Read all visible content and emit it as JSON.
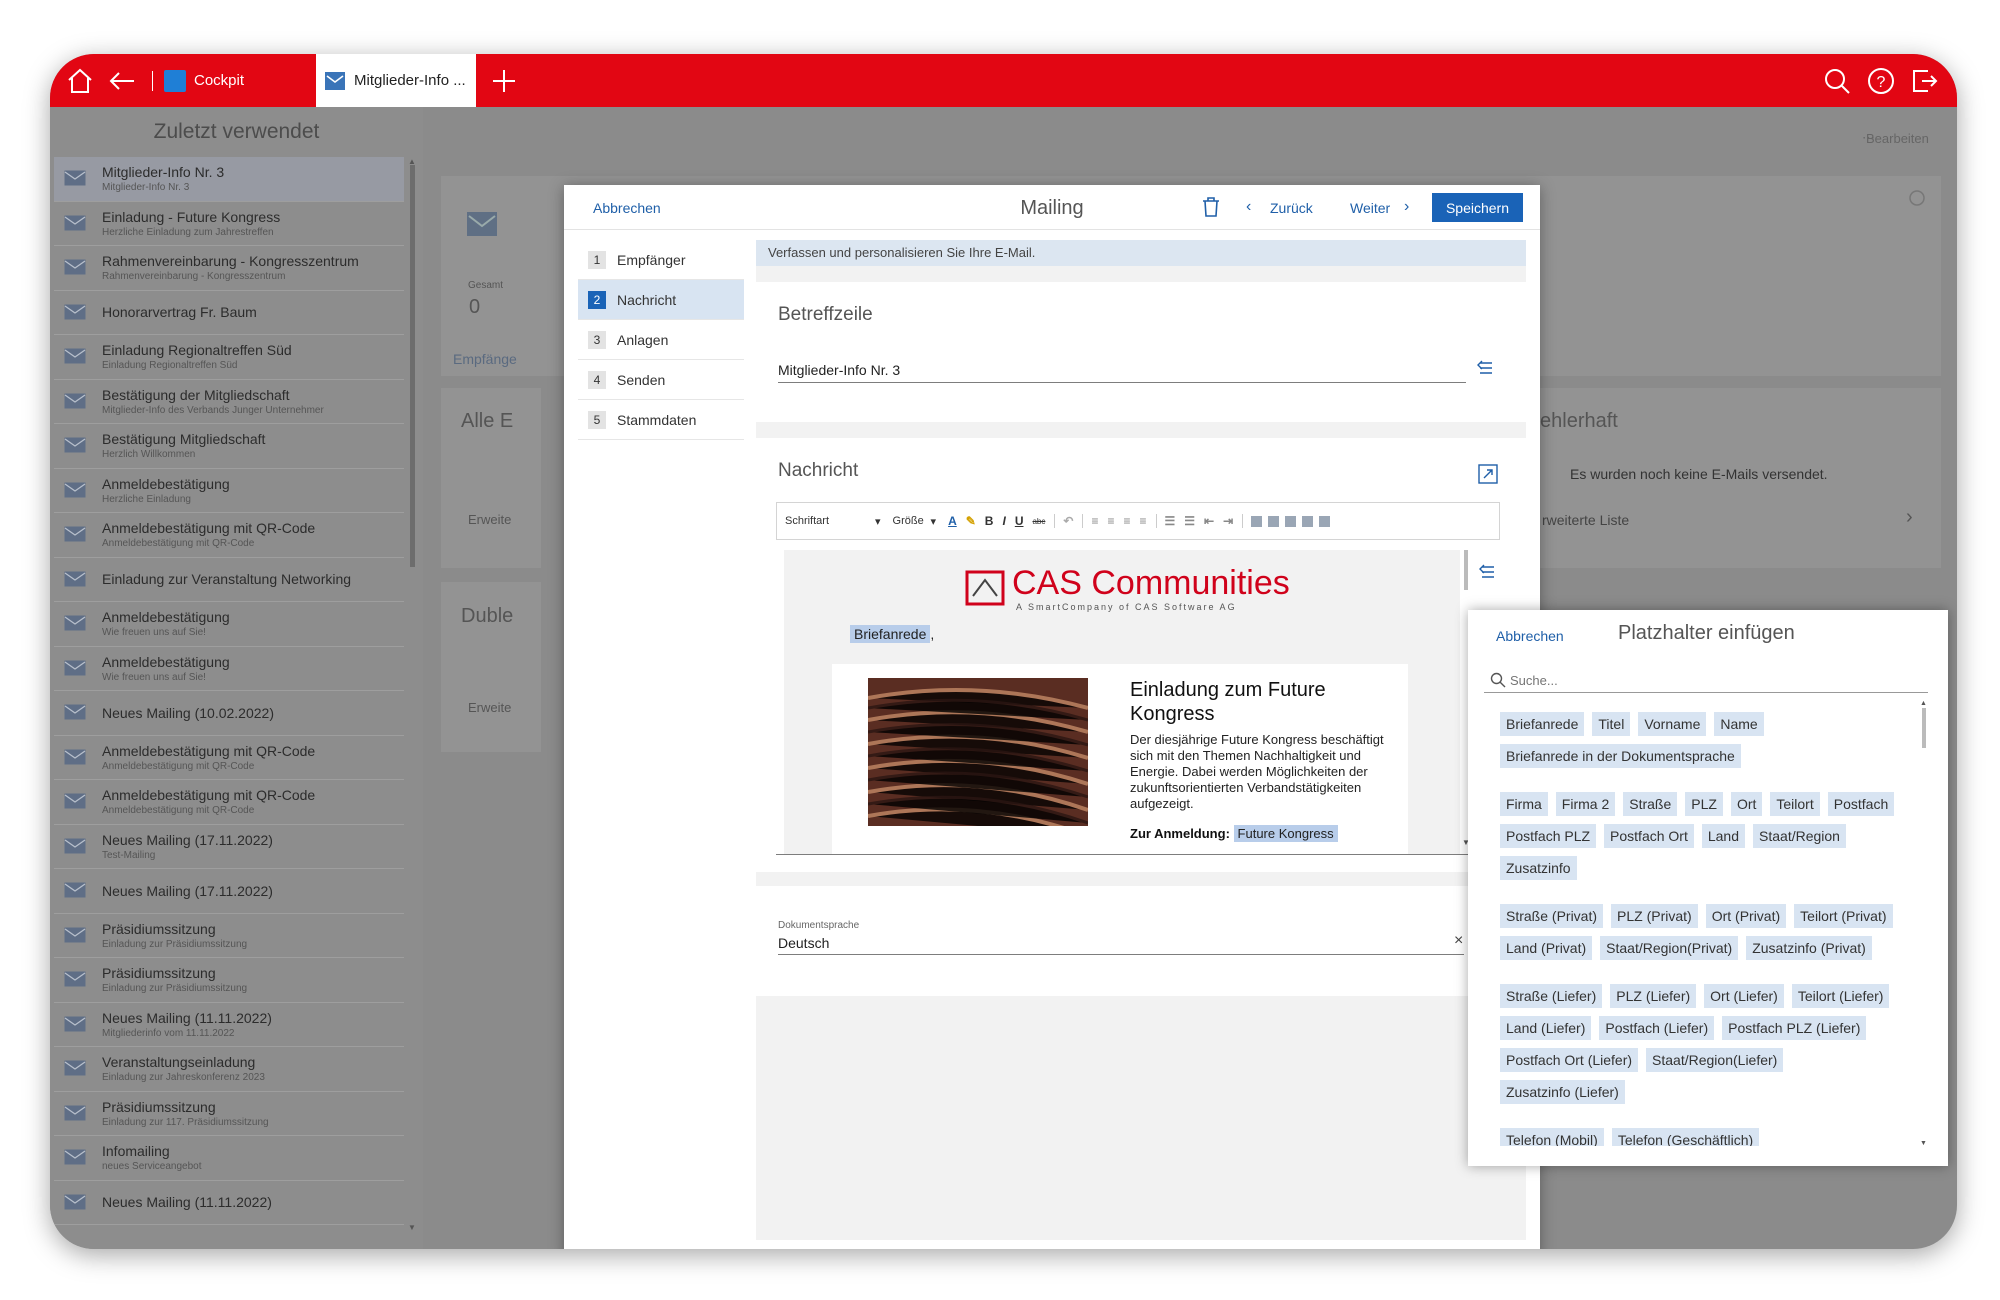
{
  "topbar": {
    "tabs": [
      {
        "label": "Cockpit"
      },
      {
        "label": "Mitglieder-Info ..."
      }
    ]
  },
  "left_panel": {
    "title": "Zuletzt verwendet",
    "items": [
      {
        "title": "Mitglieder-Info Nr. 3",
        "subtitle": "Mitglieder-Info Nr. 3"
      },
      {
        "title": "Einladung - Future Kongress",
        "subtitle": "Herzliche Einladung zum Jahrestreffen"
      },
      {
        "title": "Rahmenvereinbarung - Kongresszentrum",
        "subtitle": "Rahmenvereinbarung - Kongresszentrum"
      },
      {
        "title": "Honorarvertrag Fr. Baum",
        "subtitle": ""
      },
      {
        "title": "Einladung Regionaltreffen Süd",
        "subtitle": "Einladung Regionaltreffen Süd"
      },
      {
        "title": "Bestätigung der Mitgliedschaft",
        "subtitle": "Mitglieder-Info des Verbands Junger Unternehmer"
      },
      {
        "title": "Bestätigung Mitgliedschaft",
        "subtitle": "Herzlich Willkommen"
      },
      {
        "title": "Anmeldebestätigung",
        "subtitle": "Herzliche Einladung"
      },
      {
        "title": "Anmeldebestätigung mit QR-Code",
        "subtitle": "Anmeldebestätigung mit QR-Code"
      },
      {
        "title": "Einladung zur Veranstaltung Networking",
        "subtitle": ""
      },
      {
        "title": "Anmeldebestätigung",
        "subtitle": "Wie freuen uns auf Sie!"
      },
      {
        "title": "Anmeldebestätigung",
        "subtitle": "Wie freuen uns auf Sie!"
      },
      {
        "title": "Neues Mailing (10.02.2022)",
        "subtitle": ""
      },
      {
        "title": "Anmeldebestätigung mit QR-Code",
        "subtitle": "Anmeldebestätigung mit QR-Code"
      },
      {
        "title": "Anmeldebestätigung mit QR-Code",
        "subtitle": "Anmeldebestätigung mit QR-Code"
      },
      {
        "title": "Neues Mailing (17.11.2022)",
        "subtitle": "Test-Mailing"
      },
      {
        "title": "Neues Mailing (17.11.2022)",
        "subtitle": ""
      },
      {
        "title": "Präsidiumssitzung",
        "subtitle": "Einladung zur Präsidiumssitzung"
      },
      {
        "title": "Präsidiumssitzung",
        "subtitle": "Einladung zur Präsidiumssitzung"
      },
      {
        "title": "Neues Mailing (11.11.2022)",
        "subtitle": "Mitgliederinfo vom 11.11.2022"
      },
      {
        "title": "Veranstaltungseinladung",
        "subtitle": "Einladung zur Jahreskonferenz 2023"
      },
      {
        "title": "Präsidiumssitzung",
        "subtitle": "Einladung zur 117. Präsidiumssitzung"
      },
      {
        "title": "Infomailing",
        "subtitle": "neues Serviceangebot"
      },
      {
        "title": "Neues Mailing (11.11.2022)",
        "subtitle": ""
      }
    ]
  },
  "background": {
    "edit_label": "Bearbeiten",
    "gesamt_label": "Gesamt",
    "gesamt_value": "0",
    "tab_label": "Empfänge",
    "card1_title": "Alle E",
    "card1_link": "Erweite",
    "card2_title": "Duble",
    "card2_link": "Erweite",
    "right_title": "ehlerhaft",
    "right_empty": "Es wurden noch keine E-Mails versendet.",
    "right_link": "rweiterte Liste"
  },
  "dialog": {
    "cancel": "Abbrechen",
    "title": "Mailing",
    "back": "Zurück",
    "next": "Weiter",
    "save": "Speichern",
    "steps": [
      {
        "n": "1",
        "label": "Empfänger"
      },
      {
        "n": "2",
        "label": "Nachricht"
      },
      {
        "n": "3",
        "label": "Anlagen"
      },
      {
        "n": "4",
        "label": "Senden"
      },
      {
        "n": "5",
        "label": "Stammdaten"
      }
    ],
    "info": "Verfassen und personalisieren Sie Ihre E-Mail.",
    "subject_title": "Betreffzeile",
    "subject_value": "Mitglieder-Info Nr. 3",
    "message_title": "Nachricht",
    "toolbar": {
      "font": "Schriftart",
      "size": "Größe"
    },
    "editor": {
      "logo_main": "CAS Communities",
      "logo_sub": "A SmartCompany of CAS Software AG",
      "salutation_tag": "Briefanrede",
      "salutation_suffix": ",",
      "headline": "Einladung zum Future Kongress",
      "body": "Der diesjährige Future Kongress beschäftigt sich mit den Themen Nachhaltigkeit und Energie. Dabei werden Möglichkeiten der zukunftsorientierten Verbandstätigkeiten aufgezeigt.",
      "reg_label": "Zur Anmeldung:",
      "reg_link": "Future Kongress"
    },
    "lang_label": "Dokumentsprache",
    "lang_value": "Deutsch"
  },
  "popup": {
    "cancel": "Abbrechen",
    "title": "Platzhalter einfügen",
    "search_placeholder": "Suche...",
    "groups": [
      [
        "Briefanrede",
        "Titel",
        "Vorname",
        "Name",
        "Briefanrede in der Dokumentsprache"
      ],
      [
        "Firma",
        "Firma 2",
        "Straße",
        "PLZ",
        "Ort",
        "Teilort",
        "Postfach",
        "Postfach PLZ",
        "Postfach Ort",
        "Land",
        "Staat/Region",
        "Zusatzinfo"
      ],
      [
        "Straße (Privat)",
        "PLZ (Privat)",
        "Ort (Privat)",
        "Teilort (Privat)",
        "Land (Privat)",
        "Staat/Region(Privat)",
        "Zusatzinfo (Privat)"
      ],
      [
        "Straße (Liefer)",
        "PLZ (Liefer)",
        "Ort (Liefer)",
        "Teilort (Liefer)",
        "Land (Liefer)",
        "Postfach (Liefer)",
        "Postfach PLZ (Liefer)",
        "Postfach Ort (Liefer)",
        "Staat/Region(Liefer)",
        "Zusatzinfo (Liefer)"
      ],
      [
        "Telefon (Mobil)",
        "Telefon (Geschäftlich)"
      ]
    ]
  },
  "colors": {
    "brand_red": "#e20613",
    "accent_blue": "#1a63b7"
  }
}
